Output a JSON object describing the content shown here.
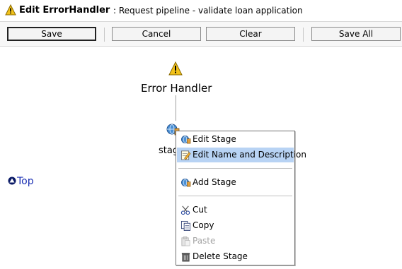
{
  "header": {
    "title_bold": "Edit ErrorHandler",
    "title_rest": ": Request pipeline - validate loan application"
  },
  "toolbar": {
    "save_label": "Save",
    "cancel_label": "Cancel",
    "clear_label": "Clear",
    "save_all_label": "Save All"
  },
  "diagram": {
    "error_handler_label": "Error Handler",
    "stage_label": "stag"
  },
  "top_link": "Top",
  "menu": {
    "edit_stage": "Edit Stage",
    "edit_name_desc": "Edit Name and Description",
    "add_stage": "Add Stage",
    "cut": "Cut",
    "copy": "Copy",
    "paste": "Paste",
    "delete_stage": "Delete Stage"
  }
}
